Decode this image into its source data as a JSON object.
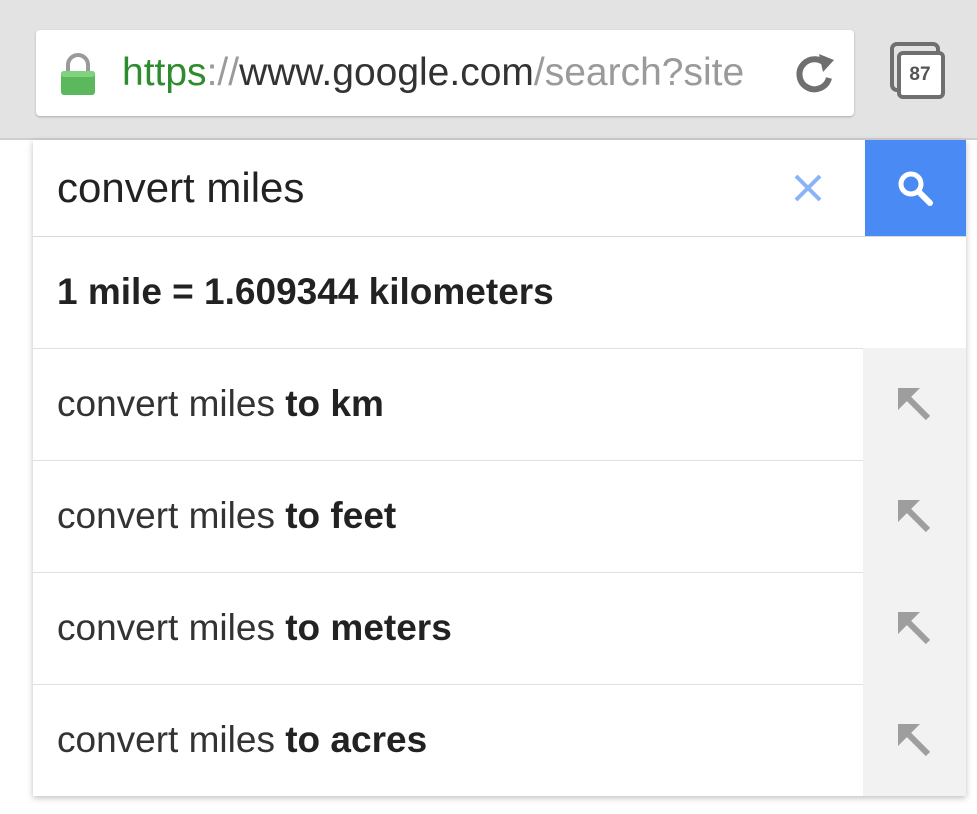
{
  "browser": {
    "url_scheme": "https",
    "url_separator": "://",
    "url_host": "www.google.com",
    "url_path": "/search?site",
    "tab_count": "87",
    "icons": {
      "lock": "lock-icon",
      "reload": "reload-icon",
      "tabs": "tab-switcher-icon"
    },
    "colors": {
      "secure": "#2e8b2e",
      "toolbar": "#e3e3e3"
    }
  },
  "search": {
    "query": "convert miles",
    "icons": {
      "clear": "close-icon",
      "submit": "search-icon"
    },
    "colors": {
      "submit_bg": "#4a8af4",
      "clear": "#8ab4f8"
    }
  },
  "answer": {
    "text": "1 mile = 1.609344 kilometers"
  },
  "suggestions": [
    {
      "prefix": "convert miles ",
      "completion": "to km",
      "icon": "arrow-up-left-icon"
    },
    {
      "prefix": "convert miles ",
      "completion": "to feet",
      "icon": "arrow-up-left-icon"
    },
    {
      "prefix": "convert miles ",
      "completion": "to meters",
      "icon": "arrow-up-left-icon"
    },
    {
      "prefix": "convert miles ",
      "completion": "to acres",
      "icon": "arrow-up-left-icon"
    }
  ]
}
